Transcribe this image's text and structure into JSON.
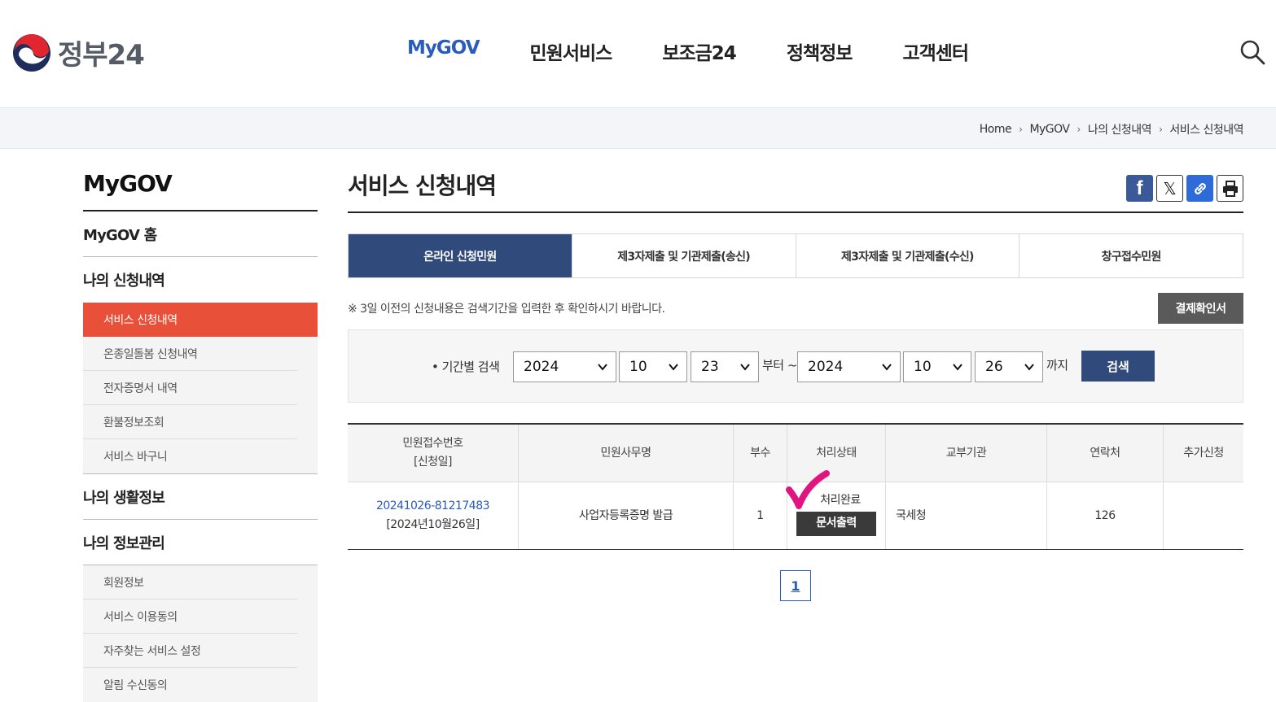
{
  "header": {
    "logo_text": "정부24",
    "nav": [
      "MyGOV",
      "민원서비스",
      "보조금24",
      "정책정보",
      "고객센터"
    ],
    "active_nav": "MyGOV"
  },
  "breadcrumb": [
    "Home",
    "MyGOV",
    "나의 신청내역",
    "서비스 신청내역"
  ],
  "sidebar": {
    "title": "MyGOV",
    "home": "MyGOV 홈",
    "group1": {
      "label": "나의 신청내역",
      "items": [
        "서비스 신청내역",
        "온종일돌봄 신청내역",
        "전자증명서 내역",
        "환불정보조회",
        "서비스 바구니"
      ]
    },
    "group2": {
      "label": "나의 생활정보"
    },
    "group3": {
      "label": "나의 정보관리",
      "items": [
        "회원정보",
        "서비스 이용동의",
        "자주찾는 서비스 설정",
        "알림 수신동의"
      ]
    }
  },
  "main": {
    "title": "서비스 신청내역",
    "share": {
      "facebook": "f",
      "x": "𝕏"
    },
    "tabs": [
      "온라인 신청민원",
      "제3자제출 및 기관제출(송신)",
      "제3자제출 및 기관제출(수신)",
      "창구접수민원"
    ],
    "notice": "※ 3일 이전의 신청내용은 검색기간을 입력한 후 확인하시기 바랍니다.",
    "payment_button": "결제확인서",
    "search": {
      "label": "• 기간별 검색",
      "from_year": "2024",
      "from_month": "10",
      "from_day": "23",
      "from_word": "부터 ~",
      "to_year": "2024",
      "to_month": "10",
      "to_day": "26",
      "to_word": "까지",
      "button": "검색"
    },
    "table": {
      "headers": {
        "receipt_no": "민원접수번호",
        "receipt_date": "[신청일]",
        "name": "민원사무명",
        "copies": "부수",
        "status": "처리상태",
        "agency": "교부기관",
        "contact": "연락처",
        "extra": "추가신청"
      },
      "rows": [
        {
          "receipt_no": "20241026-81217483",
          "date": "[2024년10월26일]",
          "name": "사업자등록증명 발급",
          "copies": "1",
          "status": "처리완료",
          "print_button": "문서출력",
          "agency": "국세청",
          "contact": "126",
          "extra": ""
        }
      ]
    },
    "pagination": {
      "current": "1"
    }
  },
  "colors": {
    "accent_blue": "#2a5bbf",
    "navy": "#2f4a7b",
    "sidebar_active": "#e8503a",
    "check_mark": "#e0157f"
  }
}
